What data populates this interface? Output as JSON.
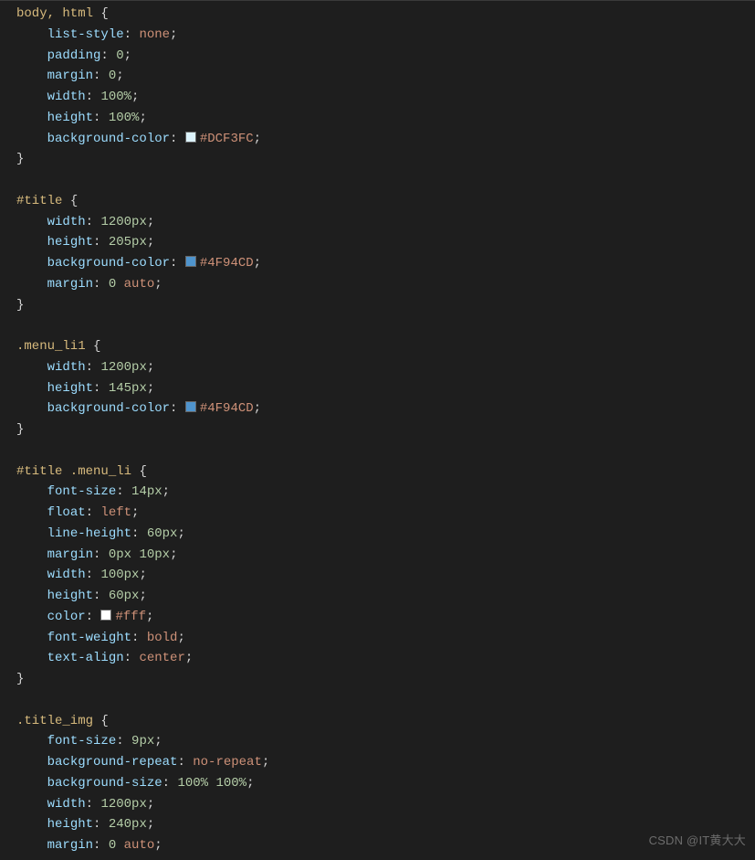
{
  "watermark": "CSDN @IT黄大大",
  "swatches": {
    "dcf3fc": "#DCF3FC",
    "4f94cd": "#4F94CD",
    "fff": "#ffffff"
  },
  "css_blocks": [
    {
      "selector": "body, html",
      "decls": [
        {
          "prop": "list-style",
          "parts": [
            {
              "t": "key",
              "v": "none"
            }
          ]
        },
        {
          "prop": "padding",
          "parts": [
            {
              "t": "num",
              "v": "0"
            }
          ]
        },
        {
          "prop": "margin",
          "parts": [
            {
              "t": "num",
              "v": "0"
            }
          ]
        },
        {
          "prop": "width",
          "parts": [
            {
              "t": "num",
              "v": "100%"
            }
          ]
        },
        {
          "prop": "height",
          "parts": [
            {
              "t": "num",
              "v": "100%"
            }
          ]
        },
        {
          "prop": "background-color",
          "parts": [
            {
              "t": "swatch",
              "v": "dcf3fc"
            },
            {
              "t": "hex",
              "v": "#DCF3FC"
            }
          ]
        }
      ]
    },
    {
      "selector": "#title",
      "decls": [
        {
          "prop": "width",
          "parts": [
            {
              "t": "num",
              "v": "1200px"
            }
          ]
        },
        {
          "prop": "height",
          "parts": [
            {
              "t": "num",
              "v": "205px"
            }
          ]
        },
        {
          "prop": "background-color",
          "parts": [
            {
              "t": "swatch",
              "v": "4f94cd"
            },
            {
              "t": "hex",
              "v": "#4F94CD"
            }
          ]
        },
        {
          "prop": "margin",
          "parts": [
            {
              "t": "num",
              "v": "0"
            },
            {
              "t": "sp"
            },
            {
              "t": "key",
              "v": "auto"
            }
          ]
        }
      ]
    },
    {
      "selector": ".menu_li1",
      "decls": [
        {
          "prop": "width",
          "parts": [
            {
              "t": "num",
              "v": "1200px"
            }
          ]
        },
        {
          "prop": "height",
          "parts": [
            {
              "t": "num",
              "v": "145px"
            }
          ]
        },
        {
          "prop": "background-color",
          "parts": [
            {
              "t": "swatch",
              "v": "4f94cd"
            },
            {
              "t": "hex",
              "v": "#4F94CD"
            }
          ]
        }
      ]
    },
    {
      "selector": "#title .menu_li",
      "decls": [
        {
          "prop": "font-size",
          "parts": [
            {
              "t": "num",
              "v": "14px"
            }
          ]
        },
        {
          "prop": "float",
          "parts": [
            {
              "t": "key",
              "v": "left"
            }
          ]
        },
        {
          "prop": "line-height",
          "parts": [
            {
              "t": "num",
              "v": "60px"
            }
          ]
        },
        {
          "prop": "margin",
          "parts": [
            {
              "t": "num",
              "v": "0px"
            },
            {
              "t": "sp"
            },
            {
              "t": "num",
              "v": "10px"
            }
          ]
        },
        {
          "prop": "width",
          "parts": [
            {
              "t": "num",
              "v": "100px"
            }
          ]
        },
        {
          "prop": "height",
          "parts": [
            {
              "t": "num",
              "v": "60px"
            }
          ]
        },
        {
          "prop": "color",
          "parts": [
            {
              "t": "swatch",
              "v": "fff"
            },
            {
              "t": "hex",
              "v": "#fff"
            }
          ]
        },
        {
          "prop": "font-weight",
          "parts": [
            {
              "t": "key",
              "v": "bold"
            }
          ]
        },
        {
          "prop": "text-align",
          "parts": [
            {
              "t": "key",
              "v": "center"
            }
          ]
        }
      ]
    },
    {
      "selector": ".title_img",
      "open": true,
      "decls": [
        {
          "prop": "font-size",
          "parts": [
            {
              "t": "num",
              "v": "9px"
            }
          ]
        },
        {
          "prop": "background-repeat",
          "parts": [
            {
              "t": "key",
              "v": "no-repeat"
            }
          ]
        },
        {
          "prop": "background-size",
          "parts": [
            {
              "t": "num",
              "v": "100%"
            },
            {
              "t": "sp"
            },
            {
              "t": "num",
              "v": "100%"
            }
          ]
        },
        {
          "prop": "width",
          "parts": [
            {
              "t": "num",
              "v": "1200px"
            }
          ]
        },
        {
          "prop": "height",
          "parts": [
            {
              "t": "num",
              "v": "240px"
            }
          ]
        },
        {
          "prop": "margin",
          "parts": [
            {
              "t": "num",
              "v": "0"
            },
            {
              "t": "sp"
            },
            {
              "t": "key",
              "v": "auto"
            }
          ]
        }
      ]
    }
  ]
}
